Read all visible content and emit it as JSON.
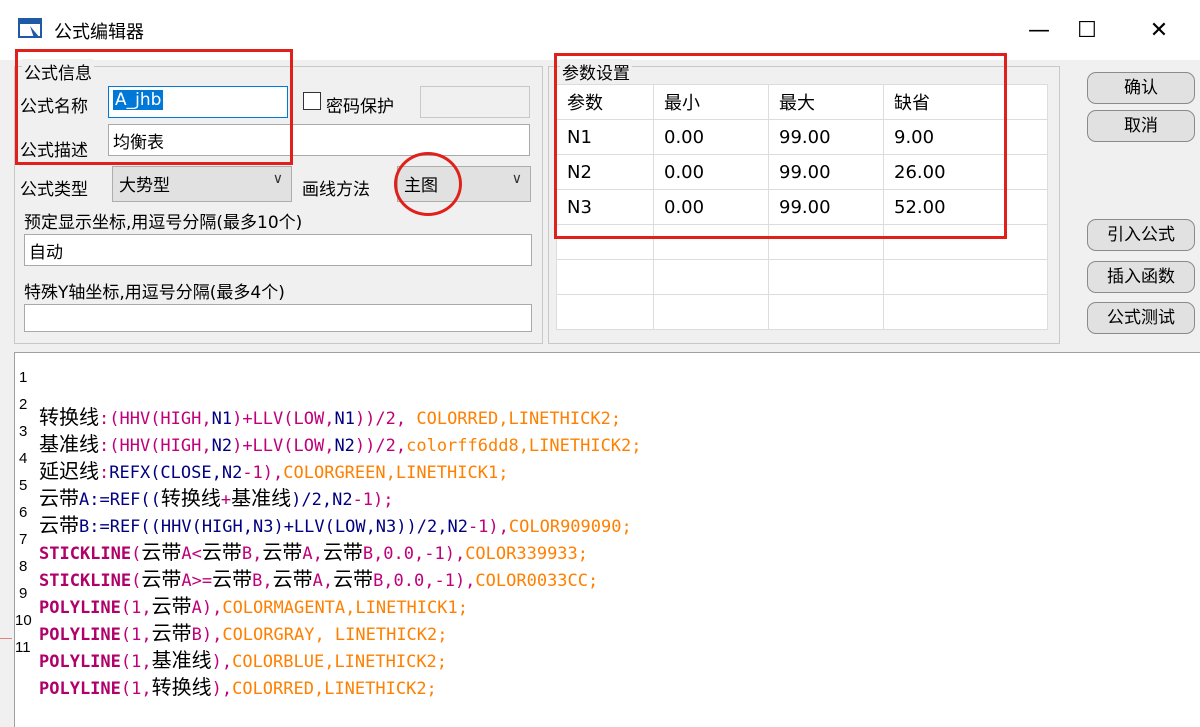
{
  "window": {
    "title": "公式编辑器",
    "minimize_glyph": "—",
    "maximize_glyph": "☐",
    "close_glyph": "✕"
  },
  "formula_info": {
    "group_label": "公式信息",
    "name_label": "公式名称",
    "name_value": "A_jhb",
    "password_label": "密码保护",
    "desc_label": "公式描述",
    "desc_value": "均衡表",
    "type_label": "公式类型",
    "type_value": "大势型",
    "draw_label": "画线方法",
    "draw_value": "主图",
    "coords_label": "预定显示坐标,用逗号分隔(最多10个)",
    "coords_value": "自动",
    "yaxis_label": "特殊Y轴坐标,用逗号分隔(最多4个)",
    "yaxis_value": ""
  },
  "params": {
    "group_label": "参数设置",
    "headers": [
      "参数",
      "最小",
      "最大",
      "缺省"
    ],
    "rows": [
      [
        "N1",
        "0.00",
        "99.00",
        "9.00"
      ],
      [
        "N2",
        "0.00",
        "99.00",
        "26.00"
      ],
      [
        "N3",
        "0.00",
        "99.00",
        "52.00"
      ]
    ]
  },
  "buttons": {
    "ok": "确认",
    "cancel": "取消",
    "import": "引入公式",
    "insert_func": "插入函数",
    "test": "公式测试"
  },
  "colors": {
    "annotation_red": "#e0201b",
    "selection_blue": "#0078d7"
  },
  "code_lines": [
    {
      "n": "1",
      "text": "转换线:(HHV(HIGH,N1)+LLV(LOW,N1))/2, COLORRED,LINETHICK2;"
    },
    {
      "n": "2",
      "text": "基准线:(HHV(HIGH,N2)+LLV(LOW,N2))/2,colorff6dd8,LINETHICK2;"
    },
    {
      "n": "3",
      "text": "延迟线:REFX(CLOSE,N2-1),COLORGREEN,LINETHICK1;"
    },
    {
      "n": "4",
      "text": "云带A:=REF((转换线+基准线)/2,N2-1);"
    },
    {
      "n": "5",
      "text": "云带B:=REF((HHV(HIGH,N3)+LLV(LOW,N3))/2,N2-1),COLOR909090;"
    },
    {
      "n": "6",
      "text": "STICKLINE(云带A<云带B,云带A,云带B,0.0,-1),COLOR339933;"
    },
    {
      "n": "7",
      "text": "STICKLINE(云带A>=云带B,云带A,云带B,0.0,-1),COLOR0033CC;"
    },
    {
      "n": "8",
      "text": "POLYLINE(1,云带A),COLORMAGENTA,LINETHICK1;"
    },
    {
      "n": "9",
      "text": "POLYLINE(1,云带B),COLORGRAY, LINETHICK2;"
    },
    {
      "n": "10",
      "text": "POLYLINE(1,基准线),COLORBLUE,LINETHICK2;"
    },
    {
      "n": "11",
      "text": "POLYLINE(1,转换线),COLORRED,LINETHICK2;"
    }
  ]
}
